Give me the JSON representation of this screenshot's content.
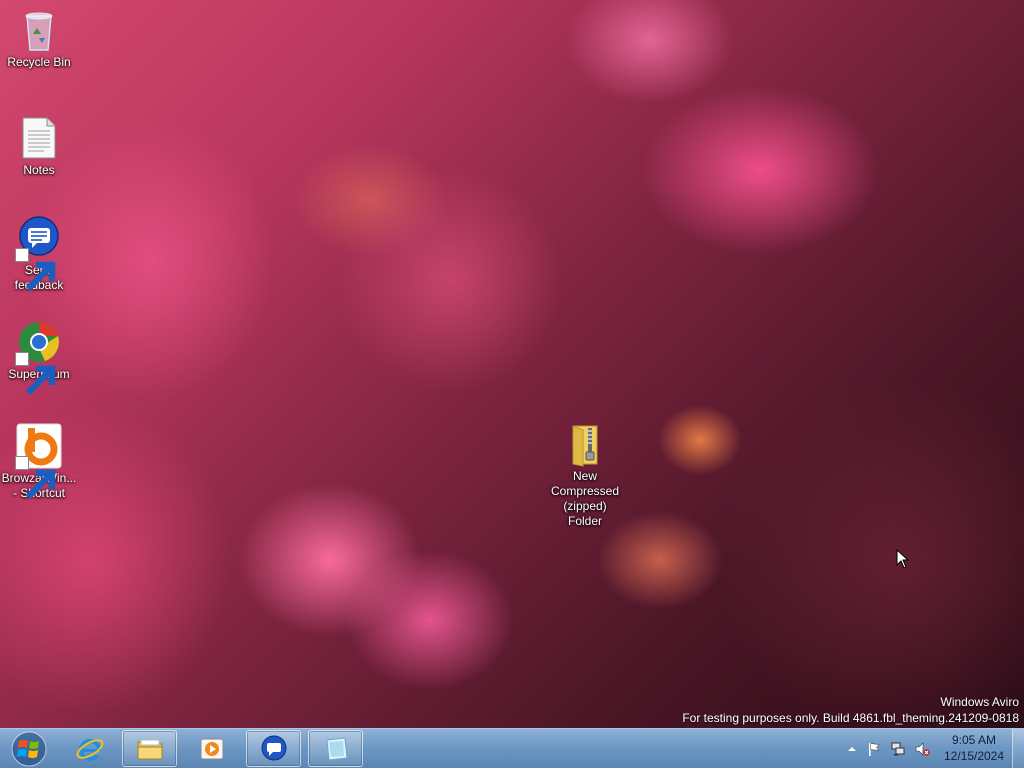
{
  "desktop": {
    "icons": [
      {
        "label": "Recycle Bin",
        "icon": "recycle-bin-icon"
      },
      {
        "label": "Notes",
        "icon": "text-document-icon"
      },
      {
        "label": "Send feedback",
        "icon": "feedback-icon"
      },
      {
        "label": "Supermium",
        "icon": "supermium-browser-icon"
      },
      {
        "label": "BrowzarWin... - Shortcut",
        "icon": "browzar-icon"
      },
      {
        "label": "New Compressed (zipped) Folder",
        "icon": "zipped-folder-icon"
      }
    ]
  },
  "watermark": {
    "line1": "Windows Aviro",
    "line2": "For testing purposes only. Build 4861.fbl_theming.241209-0818"
  },
  "taskbar": {
    "buttons": [
      {
        "icon": "internet-explorer-icon",
        "state": "pinned"
      },
      {
        "icon": "file-explorer-icon",
        "state": "open"
      },
      {
        "icon": "media-player-icon",
        "state": "pinned"
      },
      {
        "icon": "feedback-icon",
        "state": "open"
      },
      {
        "icon": "notes-app-icon",
        "state": "open"
      }
    ],
    "tray": {
      "icons": [
        "show-hidden-icons-icon",
        "action-center-flag-icon",
        "network-icon",
        "volume-muted-icon"
      ]
    },
    "clock": {
      "time": "9:05 AM",
      "date": "12/15/2024"
    }
  },
  "colors": {
    "taskbar_top": "#8fb2d6",
    "taskbar_bottom": "#5b86b4",
    "wallpaper_pink": "#d4486f"
  }
}
